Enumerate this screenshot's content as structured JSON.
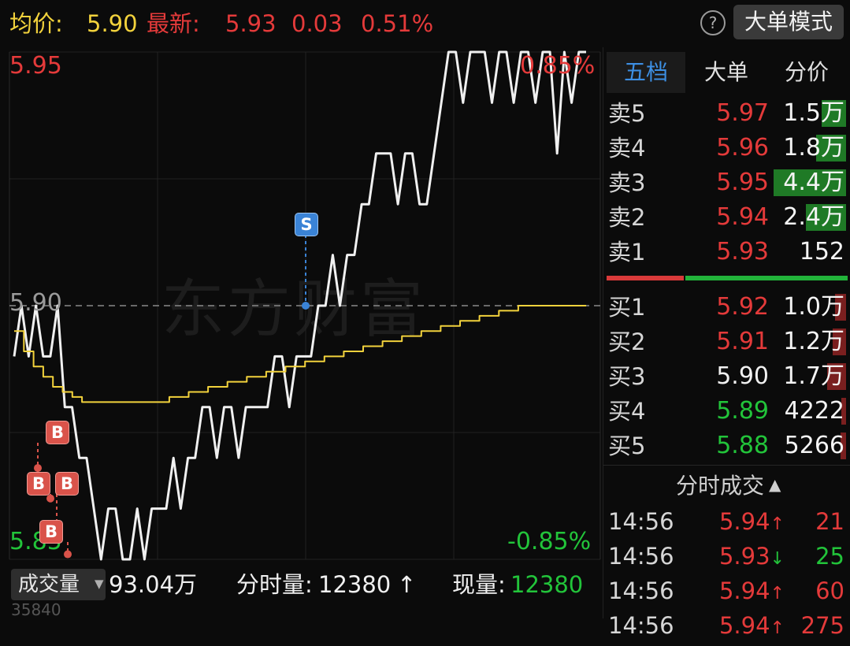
{
  "header": {
    "avg_label": "均价:",
    "avg_value": "5.90",
    "latest_label": "最新:",
    "latest_value": "5.93",
    "change": "0.03",
    "change_pct": "0.51%",
    "help_icon": "question-circle-icon",
    "mode_button": "大单模式"
  },
  "chart": {
    "y_top_price": "5.95",
    "y_mid_price": "5.90",
    "y_bottom_price": "5.85",
    "y_top_pct": "0.85%",
    "y_bottom_pct": "-0.85%",
    "watermark": "东方财富",
    "markers": {
      "buy": "B",
      "sell": "S"
    },
    "colors": {
      "price_line": "#f0f0f0",
      "avg_line": "#f2d23c",
      "buy": "#d9534a",
      "sell": "#3a83d6",
      "ref_line": "#8a8a8a"
    }
  },
  "chart_data": {
    "type": "line",
    "ylim": [
      5.85,
      5.95
    ],
    "reference_price": 5.9,
    "series": [
      {
        "name": "最新",
        "values": [
          5.89,
          5.9,
          5.89,
          5.9,
          5.89,
          5.89,
          5.9,
          5.88,
          5.88,
          5.87,
          5.87,
          5.86,
          5.85,
          5.86,
          5.86,
          5.85,
          5.85,
          5.86,
          5.85,
          5.86,
          5.86,
          5.86,
          5.87,
          5.86,
          5.87,
          5.87,
          5.88,
          5.88,
          5.87,
          5.88,
          5.88,
          5.87,
          5.88,
          5.88,
          5.88,
          5.88,
          5.89,
          5.89,
          5.88,
          5.89,
          5.89,
          5.89,
          5.9,
          5.9,
          5.91,
          5.9,
          5.91,
          5.91,
          5.92,
          5.92,
          5.93,
          5.93,
          5.93,
          5.92,
          5.93,
          5.93,
          5.92,
          5.92,
          5.93,
          5.94,
          5.95,
          5.95,
          5.94,
          5.95,
          5.95,
          5.95,
          5.94,
          5.95,
          5.95,
          5.94,
          5.95,
          5.95,
          5.94,
          5.95,
          5.95,
          5.93,
          5.95,
          5.94,
          5.95,
          5.95
        ]
      },
      {
        "name": "均价",
        "values": [
          5.895,
          5.891,
          5.888,
          5.886,
          5.884,
          5.883,
          5.882,
          5.881,
          5.881,
          5.881,
          5.881,
          5.881,
          5.881,
          5.881,
          5.881,
          5.881,
          5.882,
          5.882,
          5.883,
          5.883,
          5.884,
          5.884,
          5.885,
          5.885,
          5.886,
          5.886,
          5.887,
          5.887,
          5.888,
          5.888,
          5.889,
          5.889,
          5.89,
          5.89,
          5.891,
          5.891,
          5.892,
          5.892,
          5.893,
          5.893,
          5.894,
          5.894,
          5.895,
          5.895,
          5.896,
          5.896,
          5.897,
          5.897,
          5.898,
          5.898,
          5.899,
          5.899,
          5.9,
          5.9,
          5.9,
          5.9,
          5.9,
          5.9,
          5.9,
          5.9
        ]
      }
    ],
    "annotations": [
      {
        "text": "B",
        "series": "最新",
        "price": 5.87
      },
      {
        "text": "B",
        "series": "最新",
        "price": 5.865
      },
      {
        "text": "B",
        "series": "最新",
        "price": 5.86
      },
      {
        "text": "B",
        "series": "最新",
        "price": 5.855
      },
      {
        "text": "S",
        "series": "最新",
        "price": 5.9
      }
    ]
  },
  "volume_bar": {
    "dropdown_label": "成交量",
    "dropdown_icon": "caret-down-icon",
    "total": "93.04万",
    "period_label": "分时量:",
    "period_value": "12380",
    "period_arrow": "↑",
    "current_label": "现量:",
    "current_value": "12380",
    "axis_value": "35840"
  },
  "panel": {
    "tabs": [
      "五档",
      "大单",
      "分价"
    ],
    "asks": [
      {
        "label": "卖5",
        "price": "5.97",
        "volume": "1.5万",
        "fill": 0.34
      },
      {
        "label": "卖4",
        "price": "5.96",
        "volume": "1.8万",
        "fill": 0.41
      },
      {
        "label": "卖3",
        "price": "5.95",
        "volume": "4.4万",
        "fill": 1.0
      },
      {
        "label": "卖2",
        "price": "5.94",
        "volume": "2.4万",
        "fill": 0.55
      },
      {
        "label": "卖1",
        "price": "5.93",
        "volume": "152",
        "fill": 0.0
      }
    ],
    "bids": [
      {
        "label": "买1",
        "price": "5.92",
        "volume": "1.0万",
        "fill": 0.15
      },
      {
        "label": "买2",
        "price": "5.91",
        "volume": "1.2万",
        "fill": 0.18
      },
      {
        "label": "买3",
        "price": "5.90",
        "volume": "1.7万",
        "fill": 0.26
      },
      {
        "label": "买4",
        "price": "5.89",
        "volume": "4222",
        "fill": 0.06
      },
      {
        "label": "买5",
        "price": "5.88",
        "volume": "5266",
        "fill": 0.08
      }
    ],
    "trades_header": "分时成交",
    "trades_header_icon": "triangle-up-icon",
    "trades": [
      {
        "time": "14:56",
        "price": "5.94",
        "dir": "↑",
        "volume": "21"
      },
      {
        "time": "14:56",
        "price": "5.93",
        "dir": "↓",
        "volume": "25"
      },
      {
        "time": "14:56",
        "price": "5.94",
        "dir": "↑",
        "volume": "60"
      },
      {
        "time": "14:56",
        "price": "5.94",
        "dir": "↑",
        "volume": "275"
      }
    ]
  }
}
